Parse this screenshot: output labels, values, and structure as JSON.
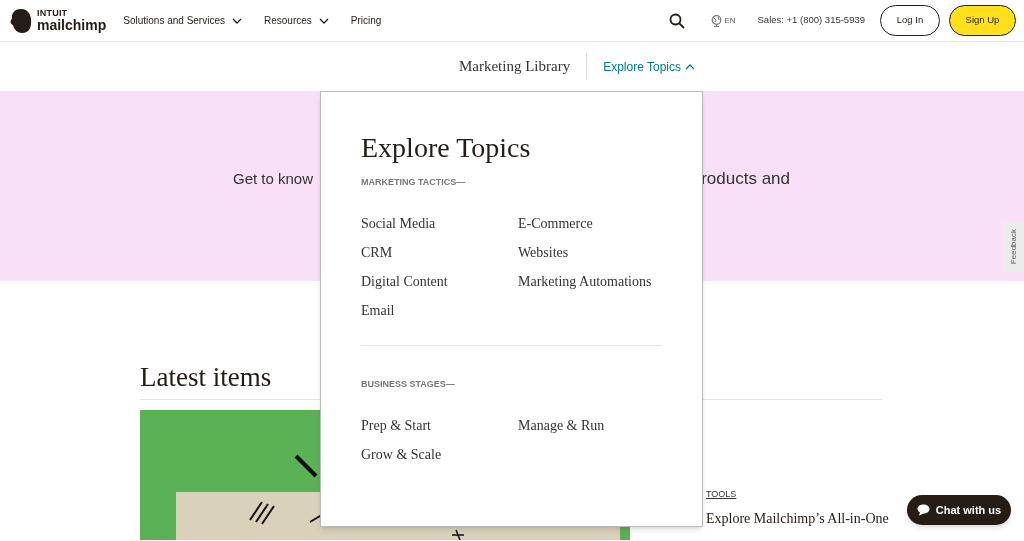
{
  "header": {
    "logo": {
      "top": "INTUIT",
      "bottom": "mailchimp"
    },
    "nav": [
      {
        "label": "Solutions and Services",
        "has_menu": true
      },
      {
        "label": "Resources",
        "has_menu": true
      },
      {
        "label": "Pricing",
        "has_menu": false
      }
    ],
    "language": "EN",
    "sales": "Sales: +1 (800) 315-5939",
    "login": "Log In",
    "signup": "Sign Up"
  },
  "subnav": {
    "title": "Marketing Library",
    "topics": {
      "label": "Explore Topics",
      "expanded": true
    }
  },
  "hero": {
    "text_left": "Get to know",
    "text_right": "roducts and"
  },
  "dropdown": {
    "title": "Explore Topics",
    "sections": [
      {
        "heading": "MARKETING TACTICS—",
        "items": [
          "Social Media",
          "E-Commerce",
          "CRM",
          "Websites",
          "Digital Content",
          "Marketing Automations",
          "Email"
        ]
      },
      {
        "heading": "BUSINESS STAGES—",
        "items": [
          "Prep & Start",
          "Manage & Run",
          "Grow & Scale"
        ]
      }
    ]
  },
  "feedback": "Feedback",
  "latest": {
    "title": "Latest items",
    "article": {
      "kind": "picture",
      "category": "TOOLS",
      "title": "Explore Mailchimp’s All-in-One"
    }
  },
  "chat": "Chat with us"
}
